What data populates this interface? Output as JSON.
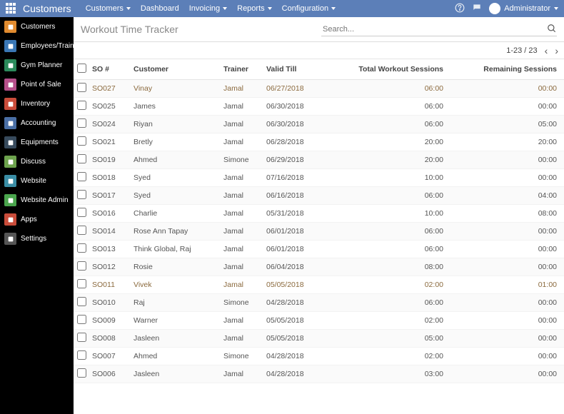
{
  "brand": "Customers",
  "topnav": [
    {
      "label": "Customers",
      "dropdown": true
    },
    {
      "label": "Dashboard",
      "dropdown": false
    },
    {
      "label": "Invoicing",
      "dropdown": true
    },
    {
      "label": "Reports",
      "dropdown": true
    },
    {
      "label": "Configuration",
      "dropdown": true
    }
  ],
  "user": "Administrator",
  "sidebar": [
    {
      "label": "Customers",
      "bg": "#e18b2f"
    },
    {
      "label": "Employees/Trainer",
      "bg": "#3a77b5"
    },
    {
      "label": "Gym Planner",
      "bg": "#2b8a5b"
    },
    {
      "label": "Point of Sale",
      "bg": "#b54f8a"
    },
    {
      "label": "Inventory",
      "bg": "#c94c3a"
    },
    {
      "label": "Accounting",
      "bg": "#4a6fa5"
    },
    {
      "label": "Equipments",
      "bg": "#374a5c"
    },
    {
      "label": "Discuss",
      "bg": "#6da34d"
    },
    {
      "label": "Website",
      "bg": "#3a8da5"
    },
    {
      "label": "Website Admin",
      "bg": "#4aa54d"
    },
    {
      "label": "Apps",
      "bg": "#c94c3a"
    },
    {
      "label": "Settings",
      "bg": "#555"
    }
  ],
  "page_title": "Workout Time Tracker",
  "search_placeholder": "Search...",
  "pager": "1-23 / 23",
  "columns": {
    "so": "SO #",
    "customer": "Customer",
    "trainer": "Trainer",
    "valid": "Valid Till",
    "total": "Total Workout Sessions",
    "remaining": "Remaining Sessions"
  },
  "rows": [
    {
      "so": "SO027",
      "customer": "Vinay",
      "trainer": "Jamal",
      "valid": "06/27/2018",
      "total": "06:00",
      "remain": "00:00",
      "hl": true
    },
    {
      "so": "SO025",
      "customer": "James",
      "trainer": "Jamal",
      "valid": "06/30/2018",
      "total": "06:00",
      "remain": "00:00"
    },
    {
      "so": "SO024",
      "customer": "Riyan",
      "trainer": "Jamal",
      "valid": "06/30/2018",
      "total": "06:00",
      "remain": "05:00"
    },
    {
      "so": "SO021",
      "customer": "Bretly",
      "trainer": "Jamal",
      "valid": "06/28/2018",
      "total": "20:00",
      "remain": "20:00"
    },
    {
      "so": "SO019",
      "customer": "Ahmed",
      "trainer": "Simone",
      "valid": "06/29/2018",
      "total": "20:00",
      "remain": "00:00"
    },
    {
      "so": "SO018",
      "customer": "Syed",
      "trainer": "Jamal",
      "valid": "07/16/2018",
      "total": "10:00",
      "remain": "00:00"
    },
    {
      "so": "SO017",
      "customer": "Syed",
      "trainer": "Jamal",
      "valid": "06/16/2018",
      "total": "06:00",
      "remain": "04:00"
    },
    {
      "so": "SO016",
      "customer": "Charlie",
      "trainer": "Jamal",
      "valid": "05/31/2018",
      "total": "10:00",
      "remain": "08:00"
    },
    {
      "so": "SO014",
      "customer": "Rose Ann Tapay",
      "trainer": "Jamal",
      "valid": "06/01/2018",
      "total": "06:00",
      "remain": "00:00"
    },
    {
      "so": "SO013",
      "customer": "Think Global, Raj",
      "trainer": "Jamal",
      "valid": "06/01/2018",
      "total": "06:00",
      "remain": "00:00"
    },
    {
      "so": "SO012",
      "customer": "Rosie",
      "trainer": "Jamal",
      "valid": "06/04/2018",
      "total": "08:00",
      "remain": "00:00"
    },
    {
      "so": "SO011",
      "customer": "Vivek",
      "trainer": "Jamal",
      "valid": "05/05/2018",
      "total": "02:00",
      "remain": "01:00",
      "hl": true
    },
    {
      "so": "SO010",
      "customer": "Raj",
      "trainer": "Simone",
      "valid": "04/28/2018",
      "total": "06:00",
      "remain": "00:00"
    },
    {
      "so": "SO009",
      "customer": "Warner",
      "trainer": "Jamal",
      "valid": "05/05/2018",
      "total": "02:00",
      "remain": "00:00"
    },
    {
      "so": "SO008",
      "customer": "Jasleen",
      "trainer": "Jamal",
      "valid": "05/05/2018",
      "total": "05:00",
      "remain": "00:00"
    },
    {
      "so": "SO007",
      "customer": "Ahmed",
      "trainer": "Simone",
      "valid": "04/28/2018",
      "total": "02:00",
      "remain": "00:00"
    },
    {
      "so": "SO006",
      "customer": "Jasleen",
      "trainer": "Jamal",
      "valid": "04/28/2018",
      "total": "03:00",
      "remain": "00:00"
    }
  ]
}
